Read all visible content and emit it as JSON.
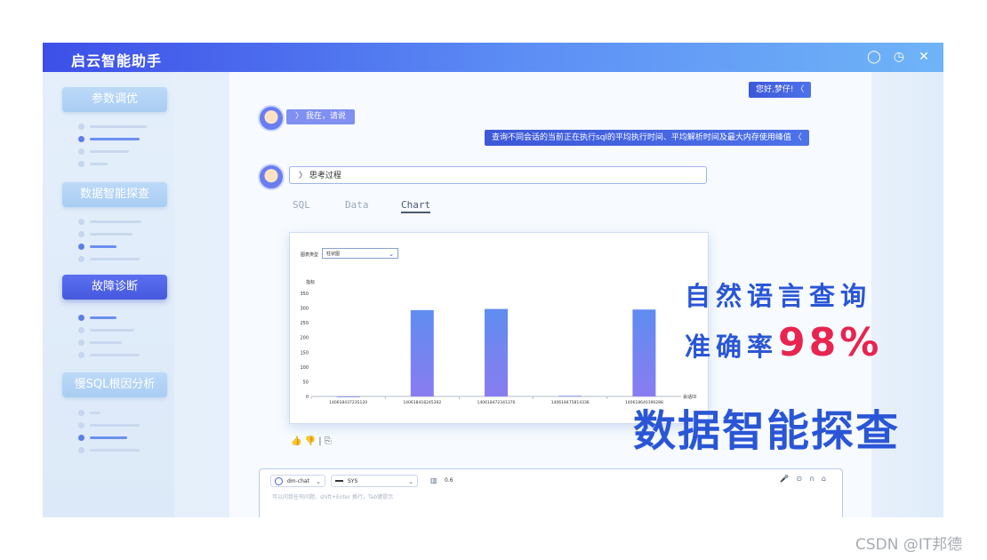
{
  "app": {
    "title": "启云智能助手"
  },
  "window_icons": [
    {
      "icon": "chat-bubble-icon",
      "glyph": "◯"
    },
    {
      "icon": "clock-icon",
      "glyph": "◷"
    },
    {
      "icon": "close-icon",
      "glyph": "✕"
    }
  ],
  "sidebar": {
    "sections": [
      {
        "label": "参数调优",
        "active": false
      },
      {
        "label": "数据智能探查",
        "active": false
      },
      {
        "label": "故障诊断",
        "active": true
      },
      {
        "label": "慢SQL根因分析",
        "active": false
      }
    ]
  },
  "chat": {
    "greeting": "您好,梦仔!  〈",
    "bot_reply": "〉 我在，请说",
    "user_query": "查询不同会话的当前正在执行sql的平均执行时间、平均解析时间及最大内存使用峰值 〈",
    "thinking_label": "〉 思考过程",
    "tabs": [
      {
        "label": "SQL",
        "active": false
      },
      {
        "label": "Data",
        "active": false
      },
      {
        "label": "Chart",
        "active": true
      }
    ]
  },
  "chart_panel": {
    "type_label": "图表类型",
    "type_value": "柱状图",
    "accent": "#6b86f0"
  },
  "chart_data": {
    "type": "bar",
    "ylabel": "指标",
    "xlabel": "会话ID",
    "ylim": [
      0,
      350
    ],
    "yticks": [
      "0",
      "50",
      "100",
      "150",
      "200",
      "250",
      "300",
      "350"
    ],
    "categories": [
      "140618437235120",
      "140618418245392",
      "140618472341376",
      "140618475814336",
      "140618640196288"
    ],
    "values": [
      0,
      293,
      297,
      2,
      295
    ]
  },
  "feedback_icons": [
    "thumbs-up-icon",
    "thumbs-down-icon",
    "copy-icon"
  ],
  "feedback_glyphs": "👍 👎 | ⎘",
  "overlay": {
    "line1": "自然语言查询",
    "line2_prefix": "准确率",
    "line2_value": "98%",
    "line3": "数据智能探查",
    "line1_color": "#2a56d6",
    "highlight_color": "#e8244f"
  },
  "input": {
    "model": "dm-chat",
    "schema": "SYS",
    "badge": "0.6",
    "placeholder": "可以问我任何问题，shift+Enter 换行，Tab键提示"
  },
  "watermark": "CSDN @IT邦德"
}
